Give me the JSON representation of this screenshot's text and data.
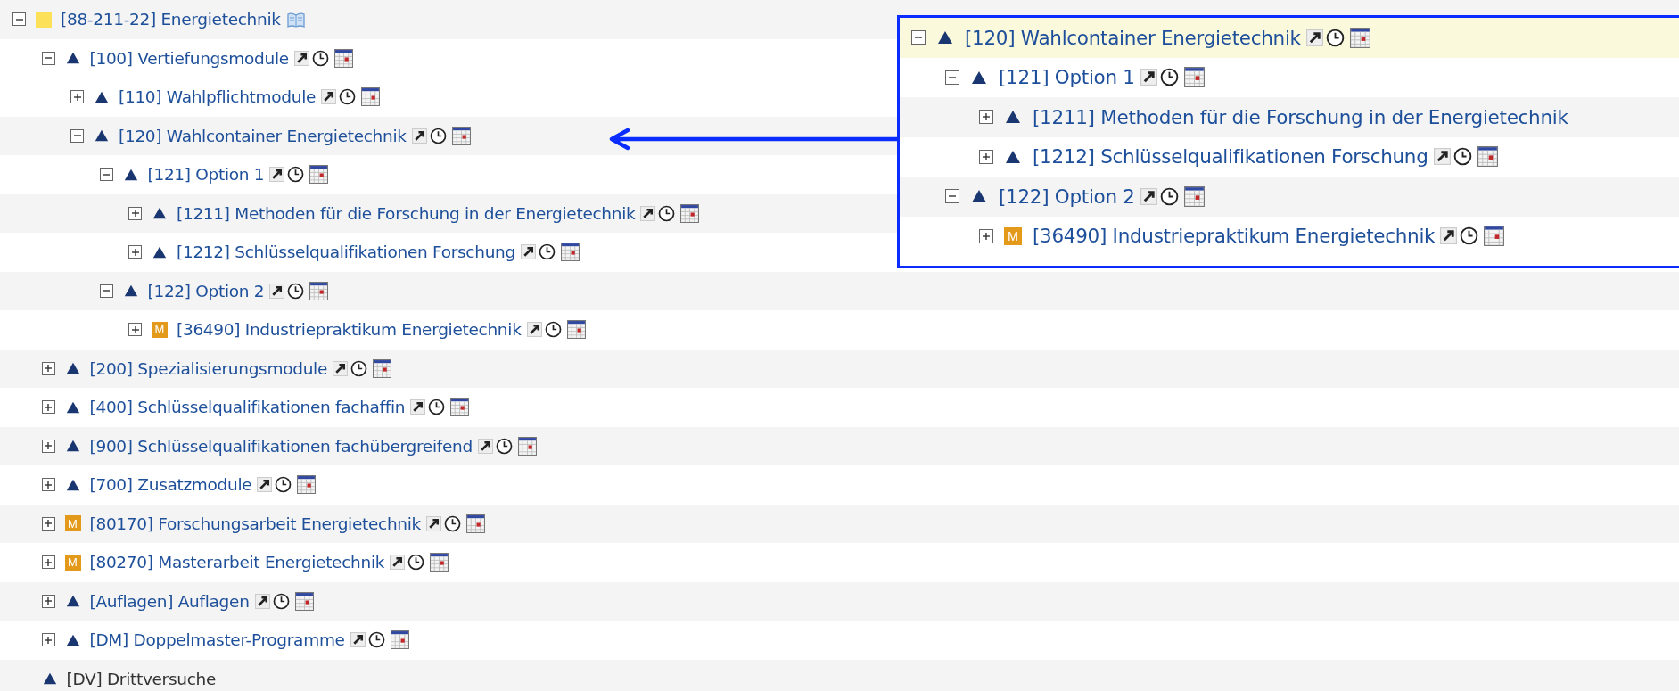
{
  "tree": [
    {
      "kind": "root",
      "label": "[88-211-22] Energietechnik",
      "expanded": true,
      "link": true,
      "actions": false,
      "book": true,
      "children": [
        {
          "kind": "group",
          "label": "[100] Vertiefungsmodule",
          "expanded": true,
          "link": true,
          "actions": true,
          "children": [
            {
              "kind": "group",
              "label": "[110] Wahlpflichtmodule",
              "expanded": false,
              "link": true,
              "actions": true
            },
            {
              "kind": "group",
              "label": "[120] Wahlcontainer Energietechnik",
              "expanded": true,
              "link": true,
              "actions": true,
              "children": [
                {
                  "kind": "group",
                  "label": "[121] Option 1",
                  "expanded": true,
                  "link": true,
                  "actions": true,
                  "children": [
                    {
                      "kind": "group",
                      "label": "[1211] Methoden für die Forschung in der Energietechnik",
                      "expanded": false,
                      "link": true,
                      "actions": true
                    },
                    {
                      "kind": "group",
                      "label": "[1212] Schlüsselqualifikationen Forschung",
                      "expanded": false,
                      "link": true,
                      "actions": true
                    }
                  ]
                },
                {
                  "kind": "group",
                  "label": "[122] Option 2",
                  "expanded": true,
                  "link": true,
                  "actions": true,
                  "children": [
                    {
                      "kind": "module",
                      "badge": "M",
                      "label": "[36490] Industriepraktikum Energietechnik",
                      "expanded": false,
                      "link": true,
                      "actions": true
                    }
                  ]
                }
              ]
            }
          ]
        },
        {
          "kind": "group",
          "label": "[200] Spezialisierungsmodule",
          "expanded": false,
          "link": true,
          "actions": true
        },
        {
          "kind": "group",
          "label": "[400] Schlüsselqualifikationen fachaffin",
          "expanded": false,
          "link": true,
          "actions": true
        },
        {
          "kind": "group",
          "label": "[900] Schlüsselqualifikationen fachübergreifend",
          "expanded": false,
          "link": true,
          "actions": true
        },
        {
          "kind": "group",
          "label": "[700] Zusatzmodule",
          "expanded": false,
          "link": true,
          "actions": true
        },
        {
          "kind": "module",
          "badge": "M",
          "label": "[80170] Forschungsarbeit Energietechnik",
          "expanded": false,
          "link": true,
          "actions": true
        },
        {
          "kind": "module",
          "badge": "M",
          "label": "[80270] Masterarbeit Energietechnik",
          "expanded": false,
          "link": true,
          "actions": true
        },
        {
          "kind": "group",
          "label": "[Auflagen] Auflagen",
          "expanded": false,
          "link": true,
          "actions": true
        },
        {
          "kind": "group",
          "label": "[DM] Doppelmaster-Programme",
          "expanded": false,
          "link": true,
          "actions": true
        },
        {
          "kind": "group",
          "label": "[DV] Drittversuche",
          "link": false,
          "actions": false
        }
      ]
    }
  ],
  "inset": {
    "tree": [
      {
        "kind": "group",
        "label": "[120] Wahlcontainer Energietechnik",
        "expanded": true,
        "link": true,
        "actions": true,
        "highlighted": true,
        "children": [
          {
            "kind": "group",
            "label": "[121] Option 1",
            "expanded": true,
            "link": true,
            "actions": true,
            "highlighted": false,
            "children": [
              {
                "kind": "group",
                "label": "[1211] Methoden für die Forschung in der Energietechnik",
                "expanded": false,
                "link": true,
                "actions": false,
                "highlighted": false
              },
              {
                "kind": "group",
                "label": "[1212] Schlüsselqualifikationen Forschung",
                "expanded": false,
                "link": true,
                "actions": true,
                "highlighted": false
              }
            ]
          },
          {
            "kind": "group",
            "label": "[122] Option 2",
            "expanded": true,
            "link": true,
            "actions": true,
            "highlighted": false,
            "children": [
              {
                "kind": "module",
                "badge": "M",
                "label": "[36490] Industriepraktikum Energietechnik",
                "expanded": false,
                "link": true,
                "actions": true,
                "highlighted": false
              }
            ]
          }
        ]
      }
    ]
  }
}
